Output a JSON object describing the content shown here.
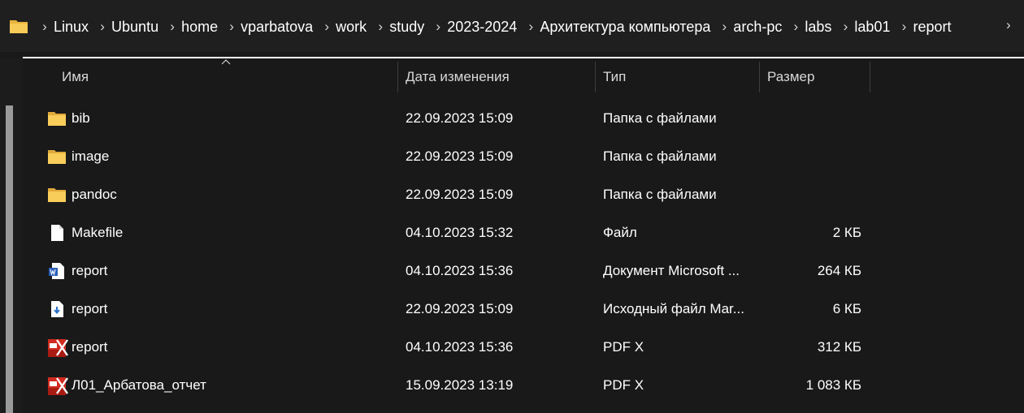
{
  "breadcrumb": [
    "Linux",
    "Ubuntu",
    "home",
    "vparbatova",
    "work",
    "study",
    "2023-2024",
    "Архитектура компьютера",
    "arch-pc",
    "labs",
    "lab01",
    "report"
  ],
  "columns": {
    "name": "Имя",
    "date": "Дата изменения",
    "type": "Тип",
    "size": "Размер"
  },
  "files": [
    {
      "icon": "folder-icon",
      "name": "bib",
      "date": "22.09.2023 15:09",
      "type": "Папка с файлами",
      "size": ""
    },
    {
      "icon": "folder-icon",
      "name": "image",
      "date": "22.09.2023 15:09",
      "type": "Папка с файлами",
      "size": ""
    },
    {
      "icon": "folder-icon",
      "name": "pandoc",
      "date": "22.09.2023 15:09",
      "type": "Папка с файлами",
      "size": ""
    },
    {
      "icon": "file-icon",
      "name": "Makefile",
      "date": "04.10.2023 15:32",
      "type": "Файл",
      "size": "2 КБ"
    },
    {
      "icon": "word-doc-icon",
      "name": "report",
      "date": "04.10.2023 15:36",
      "type": "Документ Microsoft ...",
      "size": "264 КБ"
    },
    {
      "icon": "markdown-file-icon",
      "name": "report",
      "date": "22.09.2023 15:09",
      "type": "Исходный файл Mar...",
      "size": "6 КБ"
    },
    {
      "icon": "pdf-icon",
      "name": "report",
      "date": "04.10.2023 15:36",
      "type": "PDF X",
      "size": "312 КБ"
    },
    {
      "icon": "pdf-icon",
      "name": "Л01_Арбатова_отчет",
      "date": "15.09.2023 13:19",
      "type": "PDF X",
      "size": "1 083 КБ"
    }
  ]
}
